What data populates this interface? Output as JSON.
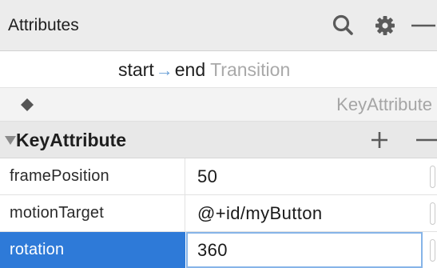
{
  "header": {
    "title": "Attributes",
    "icons": [
      "search-icon",
      "gear-icon",
      "minus-icon"
    ]
  },
  "transition": {
    "start": "start",
    "arrow": "→",
    "end": "end",
    "label": "Transition"
  },
  "keyattribute_selector": {
    "icon": "diamond-icon",
    "label": "KeyAttribute"
  },
  "section": {
    "title": "KeyAttribute",
    "expanded": true,
    "add_icon": "plus-icon",
    "remove_icon": "minus-icon"
  },
  "attributes": [
    {
      "name": "framePosition",
      "value": "50",
      "selected": false
    },
    {
      "name": "motionTarget",
      "value": "@+id/myButton",
      "selected": false
    },
    {
      "name": "rotation",
      "value": "360",
      "selected": true
    }
  ],
  "colors": {
    "selection": "#2e7ad8",
    "focus_border": "#86b4e8",
    "header_bg": "#ececec",
    "muted_text": "#a9a9a9",
    "arrow": "#6aa0d6"
  }
}
